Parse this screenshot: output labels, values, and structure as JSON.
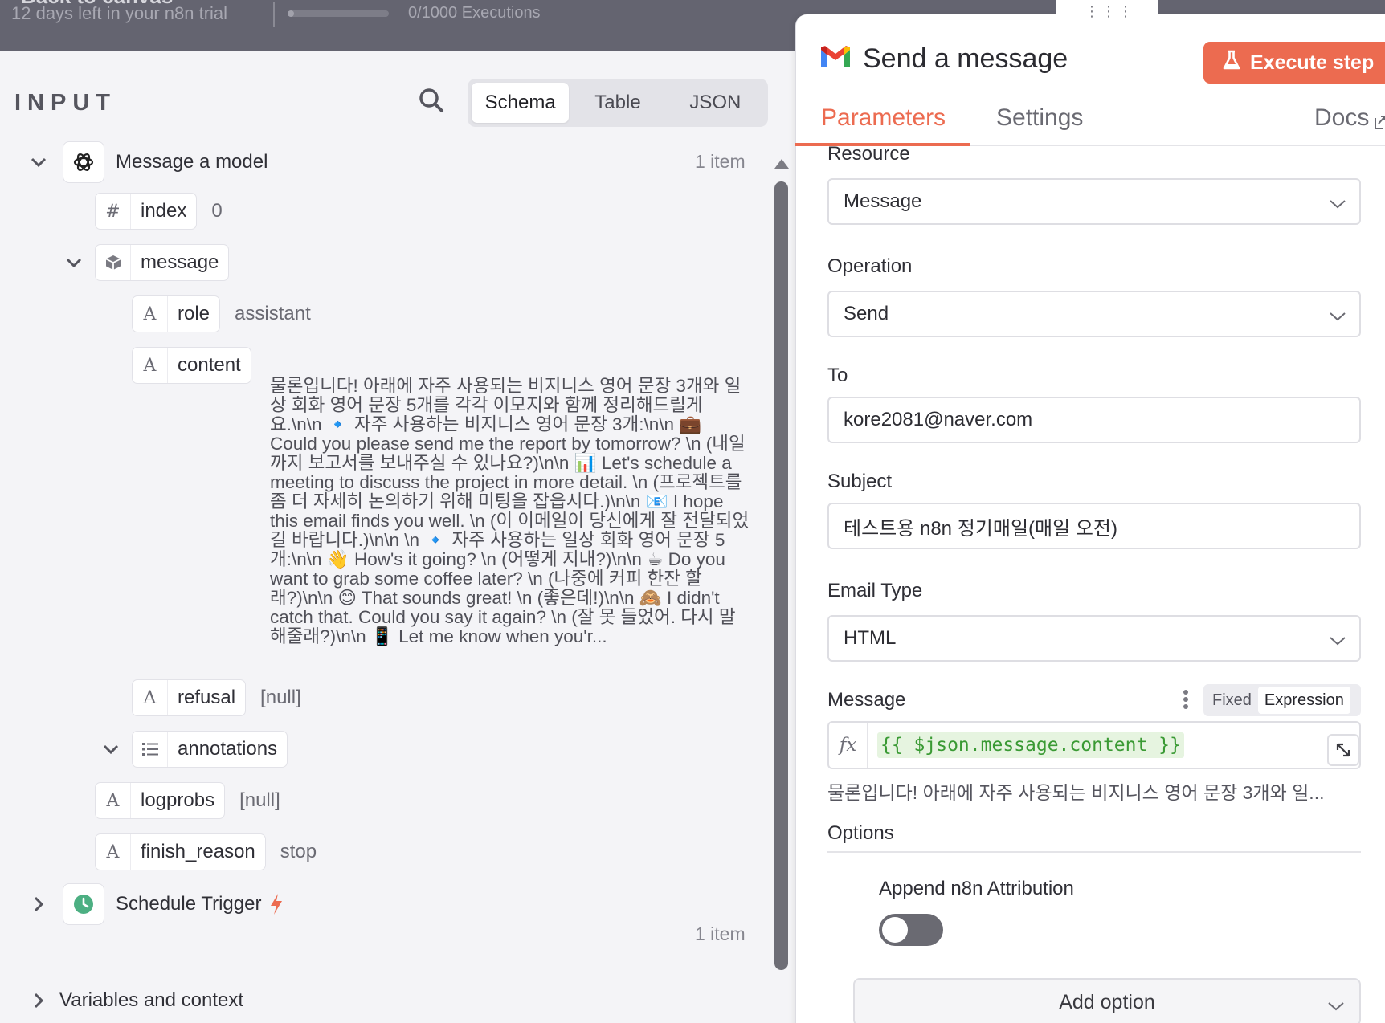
{
  "topbar": {
    "back_label": "Back to canvas",
    "trial_text": "12 days left in your n8n trial",
    "executions_text": "0/1000 Executions",
    "executions_progress": 0.0
  },
  "input_pane": {
    "title": "INPUT",
    "search_icon": "search-icon",
    "view_tabs": [
      "Schema",
      "Table",
      "JSON"
    ],
    "active_view": "Schema",
    "tree": {
      "message_model": {
        "label": "Message a model",
        "count": "1 item",
        "icon": "openai-icon"
      },
      "index": {
        "type_glyph": "#",
        "key": "index",
        "value": "0"
      },
      "message": {
        "key": "message",
        "icon": "box-icon"
      },
      "role": {
        "type_glyph": "A",
        "key": "role",
        "value": "assistant"
      },
      "content": {
        "type_glyph": "A",
        "key": "content",
        "value": "물론입니다! 아래에 자주 사용되는 비지니스 영어 문장 3개와 일상 회화 영어 문장 5개를 각각 이모지와 함께 정리해드릴게요.\\n\\n 🔹 자주 사용하는 비지니스 영어 문장 3개:\\n\\n 💼 Could you please send me the report by tomorrow? \\n (내일까지 보고서를 보내주실 수 있나요?)\\n\\n 📊 Let's schedule a meeting to discuss the project in more detail. \\n (프로젝트를 좀 더 자세히 논의하기 위해 미팅을 잡읍시다.)\\n\\n 📧 I hope this email finds you well. \\n (이 이메일이 당신에게 잘 전달되었길 바랍니다.)\\n\\n \\n 🔹 자주 사용하는 일상 회화 영어 문장 5개:\\n\\n 👋 How's it going? \\n (어떻게 지내?)\\n\\n ☕ Do you want to grab some coffee later? \\n (나중에 커피 한잔 할래?)\\n\\n 😊 That sounds great! \\n (좋은데!)\\n\\n 🙈 I didn't catch that. Could you say it again? \\n (잘 못 들었어. 다시 말해줄래?)\\n\\n 📱 Let me know when you'r..."
      },
      "refusal": {
        "type_glyph": "A",
        "key": "refusal",
        "value": "[null]"
      },
      "annotations": {
        "key": "annotations",
        "icon": "list-icon"
      },
      "logprobs": {
        "type_glyph": "A",
        "key": "logprobs",
        "value": "[null]"
      },
      "finish_reason": {
        "type_glyph": "A",
        "key": "finish_reason",
        "value": "stop"
      },
      "schedule_trigger": {
        "label": "Schedule Trigger",
        "count": "1 item",
        "icon": "clock-icon",
        "badge_icon": "bolt-icon"
      },
      "variables": {
        "label": "Variables and context"
      }
    }
  },
  "panel": {
    "title": "Send a message",
    "icon": "gmail-icon",
    "execute_label": "Execute step",
    "execute_icon": "flask-icon",
    "tabs": [
      "Parameters",
      "Settings",
      "Docs"
    ],
    "active_tab": "Parameters",
    "fields": {
      "resource": {
        "label": "Resource",
        "value": "Message"
      },
      "operation": {
        "label": "Operation",
        "value": "Send"
      },
      "to": {
        "label": "To",
        "value": "kore2081@naver.com"
      },
      "subject": {
        "label": "Subject",
        "value": "테스트용 n8n 정기매일(매일 오전)"
      },
      "email_type": {
        "label": "Email Type",
        "value": "HTML"
      },
      "message": {
        "label": "Message",
        "modes": [
          "Fixed",
          "Expression"
        ],
        "active_mode": "Expression",
        "fx": "fx",
        "expression": "{{ $json.message.content }}",
        "preview": "물론입니다! 아래에 자주 사용되는 비지니스 영어 문장 3개와 일..."
      }
    },
    "options": {
      "label": "Options",
      "append_label": "Append n8n Attribution",
      "append_enabled": false,
      "add_option_label": "Add option"
    }
  },
  "colors": {
    "accent": "#ec6b50",
    "topbar": "#646470",
    "expression_bg": "#e6f4e0",
    "expression_text": "#3a9a34"
  }
}
